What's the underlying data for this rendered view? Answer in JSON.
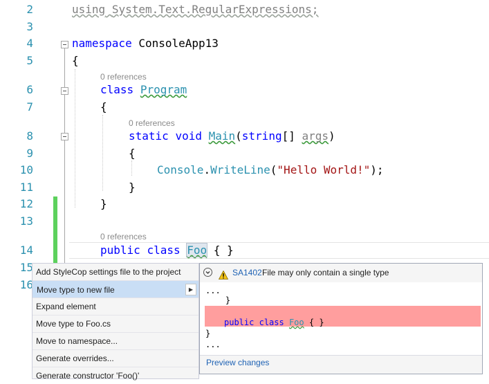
{
  "editor": {
    "lines": [
      {
        "number": "2",
        "using_kw": "using",
        "using_ns": "System.Text.RegularExpressions;"
      },
      {
        "number": "3"
      },
      {
        "number": "4",
        "kw": "namespace",
        "name": "ConsoleApp13"
      },
      {
        "number": "5",
        "text": "{"
      },
      {
        "number": "6",
        "kw": "class",
        "name": "Program"
      },
      {
        "number": "7",
        "text": "{"
      },
      {
        "number": "8",
        "kw1": "static",
        "kw2": "void",
        "method": "Main",
        "open": "(",
        "ptype": "string",
        "brackets": "[] ",
        "param": "args",
        "close": ")"
      },
      {
        "number": "9",
        "text": "{"
      },
      {
        "number": "10",
        "type": "Console",
        "dot": ".",
        "method": "WriteLine",
        "open": "(",
        "string": "\"Hello World!\"",
        "close": ");"
      },
      {
        "number": "11",
        "text": "}"
      },
      {
        "number": "12",
        "text": "}"
      },
      {
        "number": "13"
      },
      {
        "number": "14",
        "kw1": "public",
        "kw2": "class",
        "name": "Foo",
        "body": " { }"
      },
      {
        "number": "15"
      },
      {
        "number": "16"
      }
    ],
    "lens_references": "0 references"
  },
  "quick_actions_menu": {
    "items": [
      "Add StyleCop settings file to the project",
      "Move type to new file",
      "Expand element",
      "Move type to Foo.cs",
      "Move to namespace...",
      "Generate overrides...",
      "Generate constructor 'Foo()'"
    ],
    "selected_index": 1
  },
  "preview_panel": {
    "rule_code": "SA1402",
    "rule_message": "File may only contain a single type",
    "code": {
      "ellipsis_top": "...",
      "brace1": "    }",
      "removed_kw1": "public",
      "removed_kw2": "class",
      "removed_name": "Foo",
      "removed_body": " { }",
      "brace2": "}",
      "ellipsis_bottom": "..."
    },
    "footer_link": "Preview changes"
  },
  "colors": {
    "keyword": "#0000ff",
    "type": "#2b91af",
    "string": "#a31515",
    "line_number": "#2b91af",
    "change_bar": "#5dd15d",
    "removed_highlight": "#ff9e9e",
    "menu_selected": "#c9def5"
  }
}
